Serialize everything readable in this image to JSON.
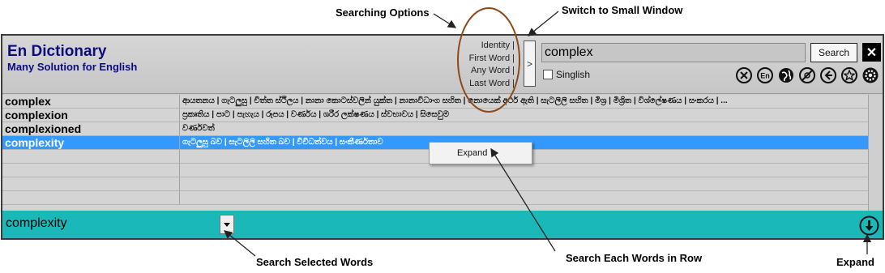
{
  "annotations": {
    "searching_options": "Searching Options",
    "switch_window": "Switch to Small Window",
    "search_selected": "Search Selected Words",
    "search_each": "Search Each Words in Row",
    "expand": "Expand"
  },
  "header": {
    "title": "En Dictionary",
    "subtitle": "Many Solution for English"
  },
  "search_options": [
    "Identity |",
    "First Word |",
    "Any Word |",
    "Last Word |"
  ],
  "switch_button": ">",
  "search": {
    "value": "complex",
    "button": "Search",
    "close": "✕",
    "singlish_label": "Singlish"
  },
  "toolbar_icons": [
    "clear-icon",
    "english-icon",
    "globe-icon",
    "no-entry-icon",
    "back-icon",
    "star-icon",
    "settings-icon"
  ],
  "rows": [
    {
      "word": "complex",
      "meaning": "ආයතනය | ගැටලුසු | චිත්ත ස්ථිලය | නානා කොටස්වලින් යුක්ත | නානාවිධාංග සහිත | නොයෙක් අර්ථ ඇති | සැටලිලි සහිත | මිශ්‍ර | මිශ්‍රිත | විශ්ලේෂණය | සංකරය | ..."
    },
    {
      "word": "complexion",
      "meaning": "ප්‍රකෘතිය | පාට | පැහැය | රූපය | වර්ණය | ශරීර ලක්ෂණය | ස්වභාවය | සිසෙවුම"
    },
    {
      "word": "complexioned",
      "meaning": "වර්ණවත්"
    },
    {
      "word": "complexity",
      "meaning": "ගැටලුසු බව | සැටලිලි සහිත බව | විවිධත්වය | සංකීර්ණතාව"
    }
  ],
  "context_menu": {
    "item": "Expand"
  },
  "bottom": {
    "selected_word": "complexity"
  },
  "colors": {
    "title": "#0c0c7e",
    "selection": "#3399ff",
    "bottom_bar": "#1ab8b8",
    "window_bg": "#c8c8c8",
    "highlight_ellipse": "#8b4a1a"
  }
}
